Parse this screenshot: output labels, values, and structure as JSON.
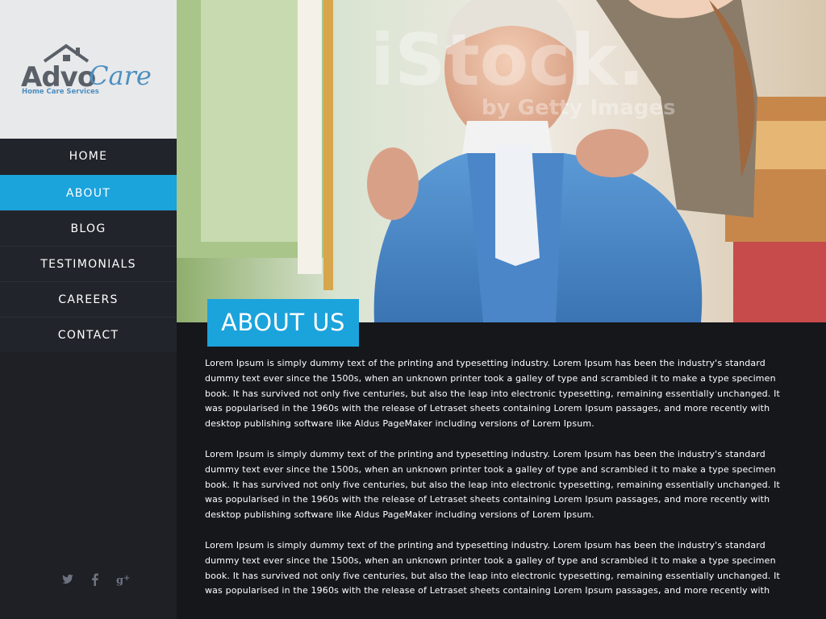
{
  "logo": {
    "advo": "Advo",
    "care": "Care",
    "tagline": "Home Care Services"
  },
  "nav": [
    {
      "label": "HOME",
      "active": false
    },
    {
      "label": "ABOUT",
      "active": true
    },
    {
      "label": "BLOG",
      "active": false
    },
    {
      "label": "TESTIMONIALS",
      "active": false
    },
    {
      "label": "CAREERS",
      "active": false
    },
    {
      "label": "CONTACT",
      "active": false
    }
  ],
  "social": [
    "twitter-icon",
    "facebook-icon",
    "google-plus-icon"
  ],
  "hero": {
    "watermark": "iStock.",
    "watermark_sub": "by Getty Images"
  },
  "page_title": "ABOUT US",
  "paragraphs": [
    [
      "Lorem Ipsum is simply dummy text of the printing and typesetting industry. Lorem Ipsum has been the industry's standard",
      "dummy text ever since the 1500s, when an unknown printer took a galley of type and scrambled it to make a type specimen",
      "book. It has survived not only five centuries, but also the leap into electronic typesetting, remaining essentially unchanged. It",
      "was popularised in the 1960s with the release of Letraset sheets containing Lorem Ipsum passages, and more recently with",
      "desktop publishing software like Aldus PageMaker including versions of Lorem Ipsum."
    ],
    [
      "Lorem Ipsum is simply dummy text of the printing and typesetting industry. Lorem Ipsum has been the industry's standard",
      "dummy text ever since the 1500s, when an unknown printer took a galley of type and scrambled it to make a type specimen",
      "book. It has survived not only five centuries, but also the leap into electronic typesetting, remaining essentially unchanged. It",
      "was popularised in the 1960s with the release of Letraset sheets containing Lorem Ipsum passages, and more recently with",
      "desktop publishing software like Aldus PageMaker including versions of Lorem Ipsum."
    ],
    [
      "Lorem Ipsum is simply dummy text of the printing and typesetting industry. Lorem Ipsum has been the industry's standard",
      "dummy text ever since the 1500s, when an unknown printer took a galley of type and scrambled it to make a type specimen",
      "book. It has survived not only five centuries, but also the leap into electronic typesetting, remaining essentially unchanged. It",
      "was popularised in the 1960s with the release of Letraset sheets containing Lorem Ipsum passages, and more recently with"
    ]
  ],
  "colors": {
    "accent": "#1ba3dc",
    "sidebar": "#1e2026",
    "content_bg": "#16171b",
    "logo_grey": "#5a6068",
    "logo_blue": "#4d8fc0"
  }
}
